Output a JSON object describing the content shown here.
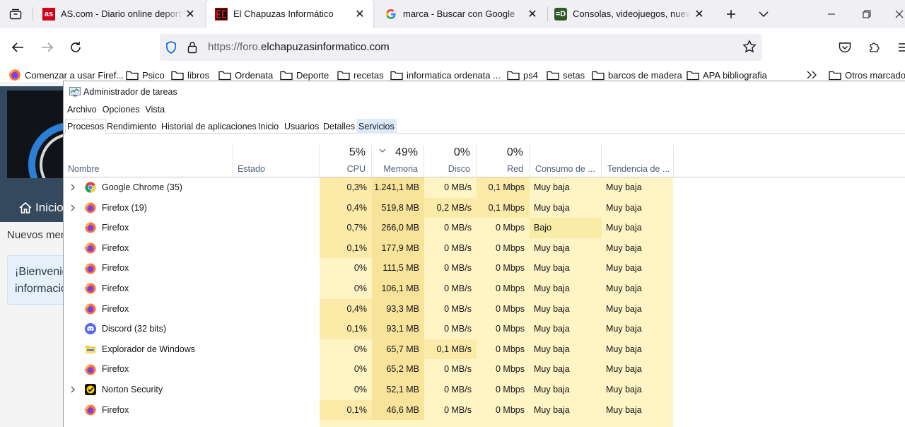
{
  "browser": {
    "tabs": [
      {
        "title": "AS.com - Diario online deportivo",
        "favicon": "as-logo",
        "active": false
      },
      {
        "title": "El Chapuzas Informático",
        "favicon": "chapuzas-logo",
        "active": true
      },
      {
        "title": "marca - Buscar con Google",
        "favicon": "google-logo",
        "active": false
      },
      {
        "title": "Consolas, videojuegos, nuevas tecnologías",
        "favicon": "game-logo",
        "active": false
      }
    ],
    "url_prefix": "https://foro.",
    "url_domain": "elchapuzasinformatico.com",
    "bookmarks": [
      {
        "label": "Comenzar a usar Firef...",
        "icon": "firefox-icon"
      },
      {
        "label": "Psico",
        "icon": "folder-icon"
      },
      {
        "label": "libros",
        "icon": "folder-icon"
      },
      {
        "label": "Ordenata",
        "icon": "folder-icon"
      },
      {
        "label": "Deporte",
        "icon": "folder-icon"
      },
      {
        "label": "recetas",
        "icon": "folder-icon"
      },
      {
        "label": "informatica ordenata ...",
        "icon": "folder-icon"
      },
      {
        "label": "ps4",
        "icon": "folder-icon"
      },
      {
        "label": "setas",
        "icon": "folder-icon"
      },
      {
        "label": "barcos de madera",
        "icon": "folder-icon"
      },
      {
        "label": "APA bibliografia",
        "icon": "folder-icon"
      }
    ],
    "other_bookmarks": "Otros marcadores"
  },
  "webpage": {
    "home_label": "Inicio",
    "new_messages": "Nuevos mensajes",
    "welcome_line1": "¡Bienvenido",
    "welcome_line2": "información"
  },
  "taskmanager": {
    "title": "Administrador de tareas",
    "menu": [
      "Archivo",
      "Opciones",
      "Vista"
    ],
    "tabs": [
      "Procesos",
      "Rendimiento",
      "Historial de aplicaciones",
      "Inicio",
      "Usuarios",
      "Detalles",
      "Servicios"
    ],
    "columns": {
      "name": "Nombre",
      "status": "Estado",
      "cpu_pct": "5%",
      "cpu": "CPU",
      "mem_pct": "49%",
      "mem": "Memoria",
      "disk_pct": "0%",
      "disk": "Disco",
      "net_pct": "0%",
      "net": "Red",
      "power": "Consumo de ...",
      "power_trend": "Tendencia de ..."
    },
    "colors": {
      "heat_light": "#fff4c4",
      "heat_mid": "#f9eca8",
      "heat_strong": "#f5e297",
      "accent_hover": "#dcebf7"
    },
    "rows": [
      {
        "name": "Google Chrome (35)",
        "icon": "chrome-icon",
        "expandable": true,
        "cpu": "0,3%",
        "mem": "1.241,1 MB",
        "disk": "0 MB/s",
        "net": "0,1 Mbps",
        "power": "Muy baja",
        "trend": "Muy baja"
      },
      {
        "name": "Firefox (19)",
        "icon": "firefox-icon",
        "expandable": true,
        "cpu": "0,4%",
        "mem": "519,8 MB",
        "disk": "0,2 MB/s",
        "net": "0,1 Mbps",
        "power": "Muy baja",
        "trend": "Muy baja"
      },
      {
        "name": "Firefox",
        "icon": "firefox-icon",
        "expandable": false,
        "cpu": "0,7%",
        "mem": "266,0 MB",
        "disk": "0 MB/s",
        "net": "0 Mbps",
        "power": "Bajo",
        "trend": "Muy baja"
      },
      {
        "name": "Firefox",
        "icon": "firefox-icon",
        "expandable": false,
        "cpu": "0,1%",
        "mem": "177,9 MB",
        "disk": "0 MB/s",
        "net": "0 Mbps",
        "power": "Muy baja",
        "trend": "Muy baja"
      },
      {
        "name": "Firefox",
        "icon": "firefox-icon",
        "expandable": false,
        "cpu": "0%",
        "mem": "111,5 MB",
        "disk": "0 MB/s",
        "net": "0 Mbps",
        "power": "Muy baja",
        "trend": "Muy baja"
      },
      {
        "name": "Firefox",
        "icon": "firefox-icon",
        "expandable": false,
        "cpu": "0%",
        "mem": "106,1 MB",
        "disk": "0 MB/s",
        "net": "0 Mbps",
        "power": "Muy baja",
        "trend": "Muy baja"
      },
      {
        "name": "Firefox",
        "icon": "firefox-icon",
        "expandable": false,
        "cpu": "0,4%",
        "mem": "93,3 MB",
        "disk": "0 MB/s",
        "net": "0 Mbps",
        "power": "Muy baja",
        "trend": "Muy baja"
      },
      {
        "name": "Discord (32 bits)",
        "icon": "discord-icon",
        "expandable": false,
        "cpu": "0,1%",
        "mem": "93,1 MB",
        "disk": "0 MB/s",
        "net": "0 Mbps",
        "power": "Muy baja",
        "trend": "Muy baja"
      },
      {
        "name": "Explorador de Windows",
        "icon": "explorer-icon",
        "expandable": false,
        "cpu": "0%",
        "mem": "65,7 MB",
        "disk": "0,1 MB/s",
        "net": "0 Mbps",
        "power": "Muy baja",
        "trend": "Muy baja"
      },
      {
        "name": "Firefox",
        "icon": "firefox-icon",
        "expandable": false,
        "cpu": "0%",
        "mem": "65,2 MB",
        "disk": "0 MB/s",
        "net": "0 Mbps",
        "power": "Muy baja",
        "trend": "Muy baja"
      },
      {
        "name": "Norton Security",
        "icon": "norton-icon",
        "expandable": true,
        "cpu": "0%",
        "mem": "52,1 MB",
        "disk": "0 MB/s",
        "net": "0 Mbps",
        "power": "Muy baja",
        "trend": "Muy baja"
      },
      {
        "name": "Firefox",
        "icon": "firefox-icon",
        "expandable": false,
        "cpu": "0,1%",
        "mem": "46,6 MB",
        "disk": "0 MB/s",
        "net": "0 Mbps",
        "power": "Muy baja",
        "trend": "Muy baja"
      }
    ]
  }
}
